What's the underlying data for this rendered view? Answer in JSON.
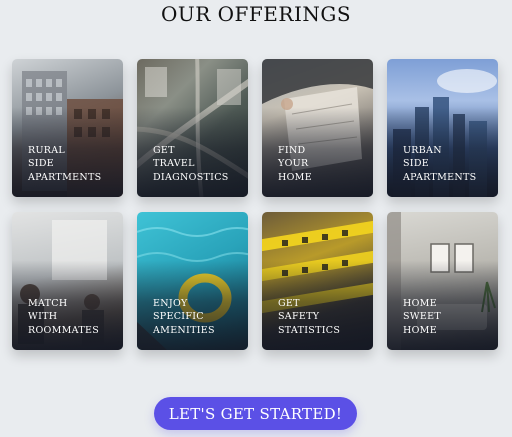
{
  "header": {
    "title": "OUR OFFERINGS"
  },
  "cards": [
    {
      "lines": [
        "RURAL",
        "SIDE",
        "APARTMENTS"
      ],
      "image": "building-photo"
    },
    {
      "lines": [
        "GET",
        "TRAVEL",
        "DIAGNOSTICS"
      ],
      "image": "highway-aerial-photo"
    },
    {
      "lines": [
        "FIND",
        "YOUR",
        "HOME"
      ],
      "image": "map-in-car-photo"
    },
    {
      "lines": [
        "URBAN",
        "SIDE",
        "APARTMENTS"
      ],
      "image": "city-skyline-photo"
    },
    {
      "lines": [
        "MATCH",
        "WITH",
        "ROOMMATES"
      ],
      "image": "people-meeting-photo"
    },
    {
      "lines": [
        "ENJOY",
        "SPECIFIC",
        "AMENITIES"
      ],
      "image": "pool-float-photo"
    },
    {
      "lines": [
        "GET",
        "SAFETY",
        "STATISTICS"
      ],
      "image": "police-tape-photo"
    },
    {
      "lines": [
        "HOME",
        "SWEET",
        "HOME"
      ],
      "image": "living-room-photo"
    }
  ],
  "cta": {
    "label": "LET'S GET STARTED!"
  },
  "colors": {
    "background": "#e9ecef",
    "accent": "#5b50e6",
    "card_text": "#ffffff"
  }
}
